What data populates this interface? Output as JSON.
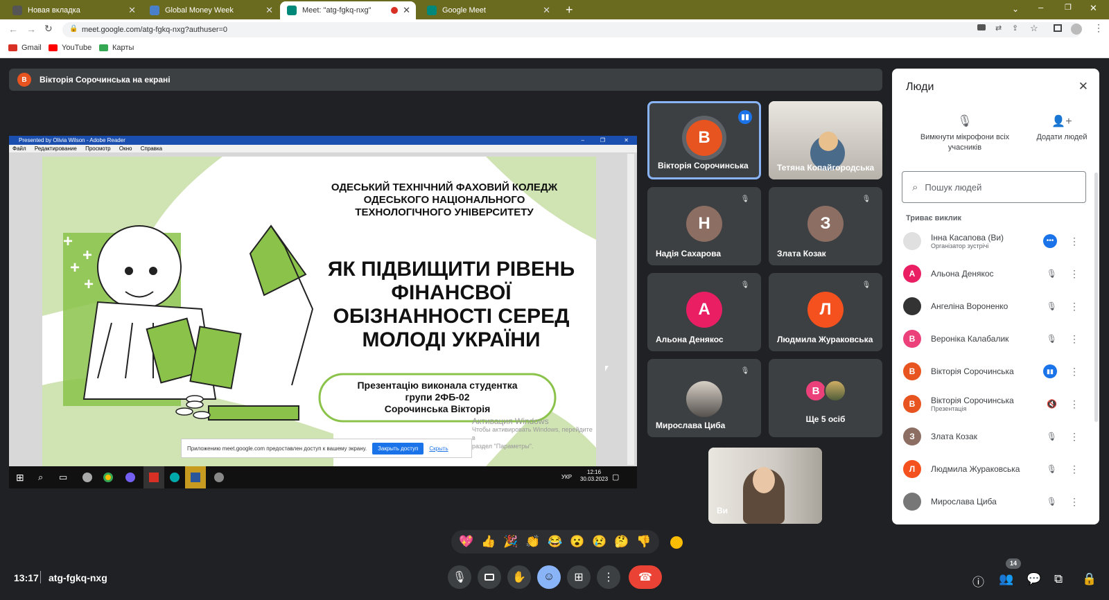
{
  "browser": {
    "tabs": [
      {
        "title": "Новая вкладка"
      },
      {
        "title": "Global Money Week"
      },
      {
        "title": "Meet: \"atg-fgkq-nxg\""
      },
      {
        "title": "Google Meet"
      }
    ],
    "url": "meet.google.com/atg-fgkq-nxg?authuser=0",
    "bookmarks": [
      "Gmail",
      "YouTube",
      "Карты"
    ]
  },
  "meet": {
    "presenting_banner": "Вікторія Сорочинська на екрані",
    "presenter_initial": "В",
    "shared_window": {
      "title": "Presented by Olivia Wilson - Adobe Reader",
      "menu": [
        "Файл",
        "Редактирование",
        "Просмотр",
        "Окно",
        "Справка"
      ],
      "slide": {
        "institution": [
          "ОДЕСЬКИЙ ТЕХНІЧНИЙ ФАХОВИЙ КОЛЕДЖ",
          "ОДЕСЬКОГО НАЦІОНАЛЬНОГО",
          "ТЕХНОЛОГІЧНОГО УНІВЕРСИТЕТУ"
        ],
        "title": [
          "ЯК ПІДВИЩИТИ РІВЕНЬ",
          "ФІНАНСВОЇ",
          "ОБІЗНАННОСТІ СЕРЕД",
          "МОЛОДІ УКРАЇНИ"
        ],
        "author": [
          "Презентацію виконала студентка",
          "групи 2ФБ-02",
          "Сорочинська Вікторія"
        ]
      },
      "watermark": [
        "Активация Windows",
        "Чтобы активировать Windows, перейдите в",
        "раздел \"Параметры\"."
      ],
      "notice": "Приложению meet.google.com предоставлен доступ к вашему экрану.",
      "notice_btn": "Закрыть доступ",
      "notice_link": "Скрыть",
      "taskbar": {
        "lang": "УКР",
        "time": "12:16",
        "date": "30.03.2023"
      }
    },
    "tiles": [
      {
        "name": "Вікторія Сорочинська",
        "initial": "В",
        "color": "#e8541f"
      },
      {
        "name": "Тетяна Копайгородська",
        "initial": "",
        "color": ""
      },
      {
        "name": "Надія Сахарова",
        "initial": "Н",
        "color": "#8d6e63"
      },
      {
        "name": "Злата Козак",
        "initial": "З",
        "color": "#8d6e63"
      },
      {
        "name": "Альона Денякос",
        "initial": "А",
        "color": "#e91e63"
      },
      {
        "name": "Людмила Жураковська",
        "initial": "Л",
        "color": "#f4511e"
      },
      {
        "name": "Мирослава Циба",
        "initial": "",
        "color": ""
      },
      {
        "name": "Ще 5 осіб",
        "initial": "В",
        "color": "#ec407a"
      }
    ],
    "self_tile": "Ви",
    "time": "13:17",
    "code": "atg-fgkq-nxg",
    "people_count": "14",
    "reactions": [
      "💖",
      "👍",
      "🎉",
      "👏",
      "😂",
      "😮",
      "😢",
      "🤔",
      "👎"
    ]
  },
  "panel": {
    "title": "Люди",
    "mute_all": "Вимкнути мікрофони всіх учасників",
    "add_people": "Додати людей",
    "search_placeholder": "Пошук людей",
    "section": "Триває виклик",
    "people": [
      {
        "name": "Інна Касапова (Ви)",
        "sub": "Організатор зустрічі",
        "initial": "",
        "color": "#bbb"
      },
      {
        "name": "Альона Денякос",
        "sub": "",
        "initial": "А",
        "color": "#e91e63"
      },
      {
        "name": "Ангеліна Вороненко",
        "sub": "",
        "initial": "",
        "color": "#333"
      },
      {
        "name": "Вероніка Калабалик",
        "sub": "",
        "initial": "В",
        "color": "#ec407a"
      },
      {
        "name": "Вікторія Сорочинська",
        "sub": "",
        "initial": "В",
        "color": "#e8541f"
      },
      {
        "name": "Вікторія Сорочинська",
        "sub": "Презентація",
        "initial": "В",
        "color": "#e8541f"
      },
      {
        "name": "Злата Козак",
        "sub": "",
        "initial": "З",
        "color": "#8d6e63"
      },
      {
        "name": "Людмила Жураковська",
        "sub": "",
        "initial": "Л",
        "color": "#f4511e"
      },
      {
        "name": "Мирослава Циба",
        "sub": "",
        "initial": "",
        "color": "#777"
      }
    ]
  }
}
